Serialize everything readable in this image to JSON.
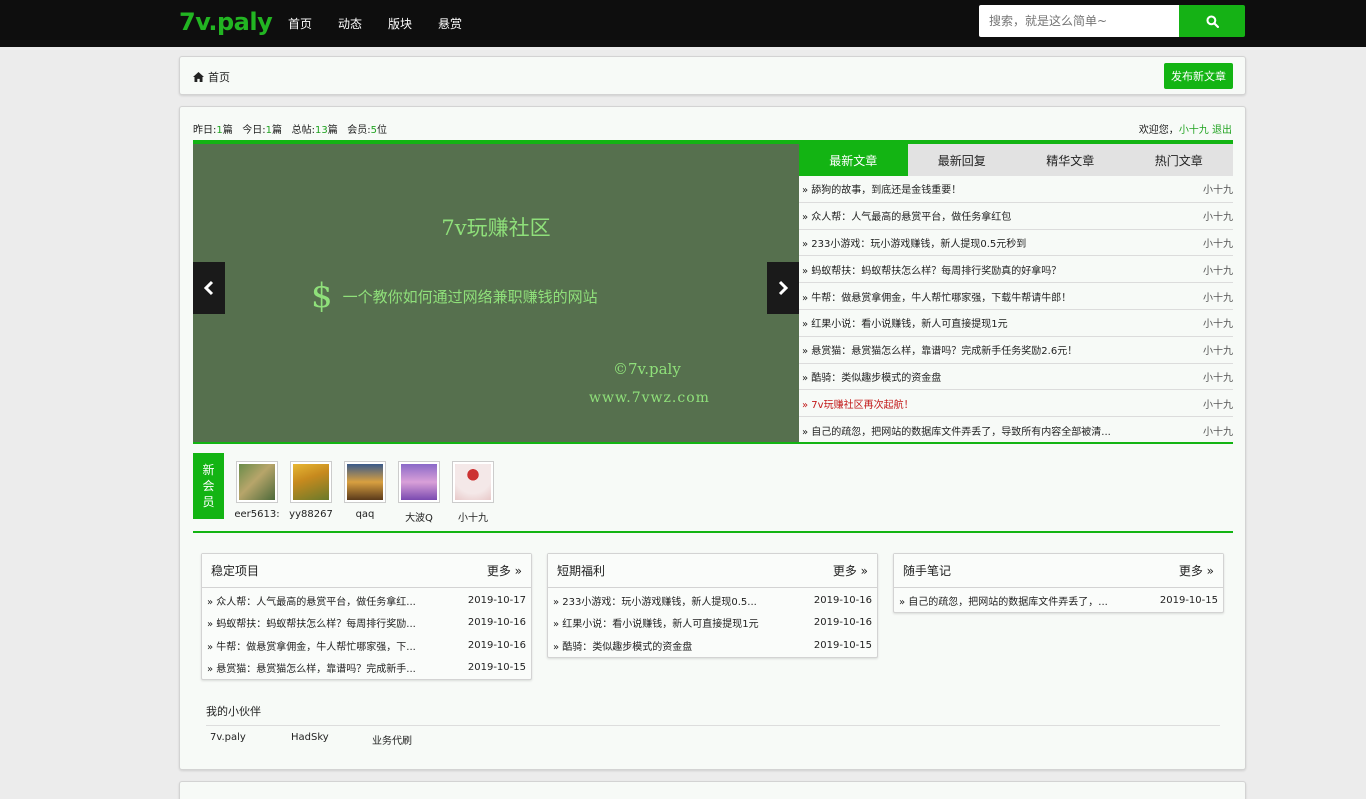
{
  "header": {
    "logo": "7v.paly",
    "nav": [
      "首页",
      "动态",
      "版块",
      "悬赏"
    ],
    "search_placeholder": "搜索，就是这么简单~"
  },
  "breadcrumb": {
    "home": "首页",
    "post_button": "发布新文章"
  },
  "stats": {
    "yesterday_label": "昨日:",
    "yesterday": "1",
    "today_label": "今日:",
    "today": "1",
    "total_label": "总帖:",
    "total": "13",
    "members_label": "会员:",
    "members": "5",
    "unit_post": "篇",
    "unit_member": "位"
  },
  "welcome": {
    "text": "欢迎您，",
    "user": "小十九",
    "logout": "退出"
  },
  "banner": {
    "title": "7v玩赚社区",
    "dollar": "$",
    "subtitle": "一个教你如何通过网络兼职赚钱的网站",
    "copyright": "©7v.paly",
    "url": "www.7vwz.com"
  },
  "tabs": [
    "最新文章",
    "最新回复",
    "精华文章",
    "热门文章"
  ],
  "articles": [
    {
      "title": "» 舔狗的故事，到底还是金钱重要！",
      "author": "小十九"
    },
    {
      "title": "» 众人帮：人气最高的悬赏平台，做任务拿红包",
      "author": "小十九"
    },
    {
      "title": "» 233小游戏：玩小游戏赚钱，新人提现0.5元秒到",
      "author": "小十九"
    },
    {
      "title": "» 蚂蚁帮扶：蚂蚁帮扶怎么样？每周排行奖励真的好拿吗？",
      "author": "小十九"
    },
    {
      "title": "» 牛帮：做悬赏拿佣金，牛人帮忙哪家强，下载牛帮请牛郎！",
      "author": "小十九"
    },
    {
      "title": "» 红果小说：看小说赚钱，新人可直接提现1元",
      "author": "小十九"
    },
    {
      "title": "» 悬赏猫：悬赏猫怎么样，靠谱吗？完成新手任务奖励2.6元！",
      "author": "小十九"
    },
    {
      "title": "» 酷骑：类似趣步模式的资金盘",
      "author": "小十九"
    },
    {
      "title": "» 7v玩赚社区再次起航！",
      "author": "小十九"
    },
    {
      "title": "» 自己的疏忽，把网站的数据库文件弄丢了，导致所有内容全部被清...",
      "author": "小十九"
    }
  ],
  "new_members": {
    "label": [
      "新",
      "会",
      "员"
    ],
    "list": [
      "eer5613:",
      "yy88267",
      "qaq",
      "大波Q",
      "小十九"
    ]
  },
  "panels": [
    {
      "title": "稳定项目",
      "more": "更多 »",
      "rows": [
        {
          "t": "» 众人帮：人气最高的悬赏平台，做任务拿红...",
          "d": "2019-10-17"
        },
        {
          "t": "» 蚂蚁帮扶：蚂蚁帮扶怎么样？每周排行奖励...",
          "d": "2019-10-16"
        },
        {
          "t": "» 牛帮：做悬赏拿佣金，牛人帮忙哪家强，下...",
          "d": "2019-10-16"
        },
        {
          "t": "» 悬赏猫：悬赏猫怎么样，靠谱吗？完成新手...",
          "d": "2019-10-15"
        }
      ]
    },
    {
      "title": "短期福利",
      "more": "更多 »",
      "rows": [
        {
          "t": "» 233小游戏：玩小游戏赚钱，新人提现0.5...",
          "d": "2019-10-16"
        },
        {
          "t": "» 红果小说：看小说赚钱，新人可直接提现1元",
          "d": "2019-10-16"
        },
        {
          "t": "» 酷骑：类似趣步模式的资金盘",
          "d": "2019-10-15"
        }
      ]
    },
    {
      "title": "随手笔记",
      "more": "更多 »",
      "rows": [
        {
          "t": "» 自己的疏忽，把网站的数据库文件弄丢了，...",
          "d": "2019-10-15"
        }
      ]
    }
  ],
  "partners": {
    "title": "我的小伙伴",
    "links": [
      "7v.paly",
      "HadSky",
      "业务代刷"
    ]
  },
  "colors": {
    "accent": "#13b413",
    "topbar": "#0e0e0e",
    "banner": "#56704e"
  }
}
